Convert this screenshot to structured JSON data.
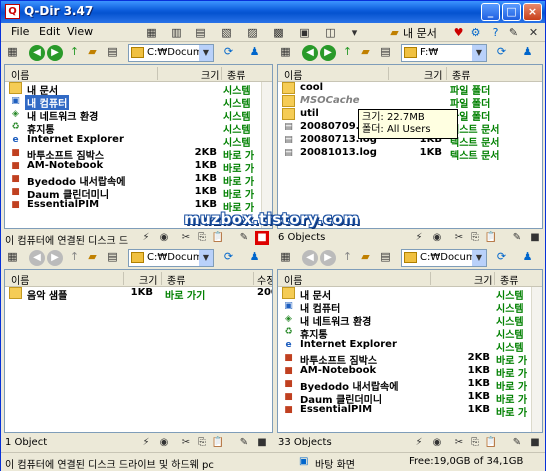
{
  "window": {
    "title": "Q-Dir 3.47"
  },
  "menu": [
    "File",
    "Edit",
    "View"
  ],
  "toolbar": {
    "my_docs_label": "내 문서"
  },
  "columns": {
    "name": "이름",
    "size": "크기",
    "type": "종류",
    "modified": "수정"
  },
  "panes": {
    "top_left": {
      "address": "C:₩Documer",
      "rows": [
        {
          "name": "내 문서",
          "size": "",
          "type": "시스템",
          "icon": "folder"
        },
        {
          "name": "내 컴퓨터",
          "size": "",
          "type": "시스템",
          "icon": "computer"
        },
        {
          "name": "내 네트워크 환경",
          "size": "",
          "type": "시스템",
          "icon": "network"
        },
        {
          "name": "휴지통",
          "size": "",
          "type": "시스템",
          "icon": "recycle"
        },
        {
          "name": "Internet Explorer",
          "size": "",
          "type": "시스템",
          "icon": "ie"
        },
        {
          "name": "바투소프트 짐박스",
          "size": "2KB",
          "type": "바로 가",
          "icon": "app"
        },
        {
          "name": "AM-Notebook",
          "size": "1KB",
          "type": "바로 가",
          "icon": "app"
        },
        {
          "name": "Byedodo 내서랍속에",
          "size": "1KB",
          "type": "바로 가",
          "icon": "app"
        },
        {
          "name": "Daum 클린더미니",
          "size": "1KB",
          "type": "바로 가",
          "icon": "app"
        },
        {
          "name": "EssentialPIM",
          "size": "1KB",
          "type": "바로 가",
          "icon": "app"
        }
      ],
      "status": "이 컴퓨터에 연결된 디스크 드"
    },
    "top_right": {
      "address": "F:₩",
      "rows": [
        {
          "name": "cool",
          "size": "",
          "type": "파일 폴더",
          "icon": "folder"
        },
        {
          "name": "MSOCache",
          "size": "",
          "type": "파일 폴더",
          "icon": "folder"
        },
        {
          "name": "util",
          "size": "",
          "type": "파일 폴더",
          "icon": "folder"
        },
        {
          "name": "20080709.log",
          "size": "1KB",
          "type": "텍스트 문서",
          "icon": "doc"
        },
        {
          "name": "20080713.log",
          "size": "1KB",
          "type": "텍스트 문서",
          "icon": "doc"
        },
        {
          "name": "20081013.log",
          "size": "1KB",
          "type": "텍스트 문서",
          "icon": "doc"
        }
      ],
      "status": "6 Objects",
      "tooltip": {
        "line1": "크기: 22.7MB",
        "line2": "폴더: All Users"
      }
    },
    "bottom_left": {
      "address": "C:₩Documer",
      "rows": [
        {
          "name": "음악 샘플",
          "size": "1KB",
          "type": "바로 가기",
          "modified": "200",
          "icon": "folder"
        }
      ],
      "status": "1 Object"
    },
    "bottom_right": {
      "address": "C:₩Docume",
      "rows": [
        {
          "name": "내 문서",
          "size": "",
          "type": "시스템",
          "icon": "folder"
        },
        {
          "name": "내 컴퓨터",
          "size": "",
          "type": "시스템",
          "icon": "computer"
        },
        {
          "name": "내 네트워크 환경",
          "size": "",
          "type": "시스템",
          "icon": "network"
        },
        {
          "name": "휴지통",
          "size": "",
          "type": "시스템",
          "icon": "recycle"
        },
        {
          "name": "Internet Explorer",
          "size": "",
          "type": "시스템",
          "icon": "ie"
        },
        {
          "name": "바투소프트 짐박스",
          "size": "2KB",
          "type": "바로 가",
          "icon": "app"
        },
        {
          "name": "AM-Notebook",
          "size": "1KB",
          "type": "바로 가",
          "icon": "app"
        },
        {
          "name": "Byedodo 내서랍속에",
          "size": "1KB",
          "type": "바로 가",
          "icon": "app"
        },
        {
          "name": "Daum 클린더미니",
          "size": "1KB",
          "type": "바로 가",
          "icon": "app"
        },
        {
          "name": "EssentialPIM",
          "size": "1KB",
          "type": "바로 가",
          "icon": "app"
        }
      ],
      "status": "33 Objects"
    }
  },
  "bottombar": {
    "left": "이 컴퓨터에 연결된 디스크 드라이브 및 하드웨 pc",
    "middle": "바탕 화면",
    "right": "Free:19,0GB of 34,1GB"
  },
  "watermark": "muzbox.tistory.com"
}
